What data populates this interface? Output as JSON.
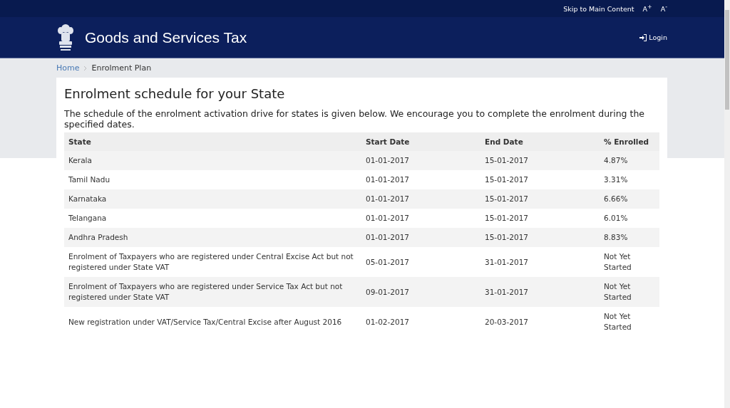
{
  "top_bar": {
    "links": [
      "Skip to Main Content",
      "A$^{+}$",
      "A$^{-}$"
    ]
  },
  "header": {
    "title": "Goods and Services Tax",
    "login": "Login"
  },
  "breadcrumb": [
    "Home",
    "Enrolment Plan"
  ],
  "heading": "Enrolment schedule for your State",
  "intro": "The schedule of the enrolment activation drive for states is given below. We encourage you to complete the enrolment during the specified dates.",
  "table": {
    "columns": [
      "State",
      "Start Date",
      "End Date",
      "% Enrolled"
    ],
    "rows": [
      [
        "Kerala",
        "01-01-2017",
        "15-01-2017",
        "4.87%"
      ],
      [
        "Tamil Nadu",
        "01-01-2017",
        "15-01-2017",
        "3.31%"
      ],
      [
        "Karnataka",
        "01-01-2017",
        "15-01-2017",
        "6.66%"
      ],
      [
        "Telangana",
        "01-01-2017",
        "15-01-2017",
        "6.01%"
      ],
      [
        "Andhra Pradesh",
        "01-01-2017",
        "15-01-2017",
        "8.83%"
      ],
      [
        "Enrolment of Taxpayers who are registered under Central Excise Act but not registered under State VAT",
        "05-01-2017",
        "31-01-2017",
        "Not Yet Started"
      ],
      [
        "Enrolment of Taxpayers who are registered under Service Tax Act but not registered under State VAT",
        "09-01-2017",
        "31-01-2017",
        "Not Yet Started"
      ],
      [
        "New registration under VAT/Service Tax/Central Excise after August 2016",
        "01-02-2017",
        "20-03-2017",
        "Not Yet Started"
      ]
    ]
  }
}
